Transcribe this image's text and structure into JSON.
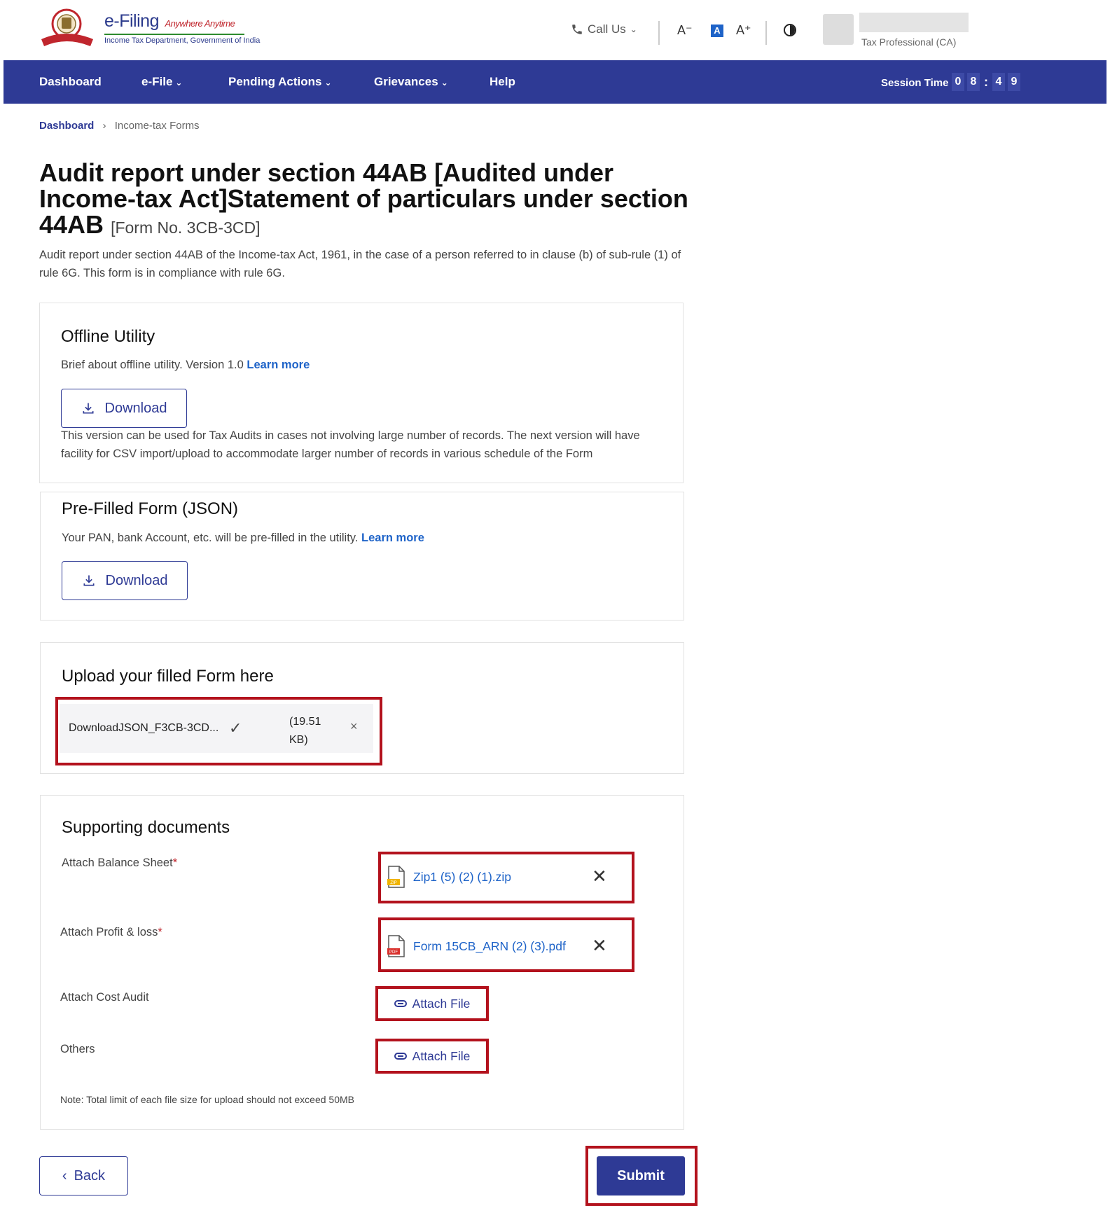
{
  "header": {
    "brand_title": "e-Filing",
    "brand_tagline": "Anywhere Anytime",
    "brand_subtitle": "Income Tax Department, Government of India",
    "call_us": "Call Us",
    "font_decrease": "A⁻",
    "font_normal": "A",
    "font_increase": "A⁺",
    "user_role": "Tax Professional (CA)"
  },
  "nav": {
    "items": [
      {
        "label": "Dashboard"
      },
      {
        "label": "e-File"
      },
      {
        "label": "Pending Actions"
      },
      {
        "label": "Grievances"
      },
      {
        "label": "Help"
      }
    ],
    "session_label": "Session Time",
    "session_digits": [
      "0",
      "8",
      "4",
      "9"
    ]
  },
  "breadcrumb": {
    "home": "Dashboard",
    "current": "Income-tax Forms"
  },
  "page": {
    "title": "Audit report under section 44AB [Audited under Income-tax Act]Statement of particulars under section 44AB",
    "form_no": "[Form No. 3CB-3CD]",
    "description": "Audit report under section 44AB of the Income-tax Act, 1961, in the case of a person referred to in clause (b) of sub-rule (1) of rule 6G. This form is in compliance with rule 6G."
  },
  "offline_utility": {
    "title": "Offline Utility",
    "brief": "Brief about offline utility. Version 1.0",
    "learn_more": "Learn more",
    "download_label": "Download",
    "info": "This version can be used for Tax Audits in cases not involving large number of records. The next version will have facility for CSV import/upload to accommodate larger number of records in various schedule of the Form"
  },
  "prefilled": {
    "title": "Pre-Filled Form (JSON)",
    "brief": "Your PAN, bank Account, etc. will be pre-filled in the utility.",
    "learn_more": "Learn more",
    "download_label": "Download"
  },
  "upload": {
    "title": "Upload your filled Form here",
    "file_name": "DownloadJSON_F3CB-3CD...",
    "file_size": "(19.51 KB)"
  },
  "supporting": {
    "title": "Supporting documents",
    "balance_sheet_label": "Attach Balance Sheet",
    "balance_sheet_file": "Zip1 (5) (2) (1).zip",
    "balance_sheet_file_type": "ZIP",
    "profit_loss_label": "Attach Profit & loss",
    "profit_loss_file": "Form 15CB_ARN (2) (3).pdf",
    "profit_loss_file_type": "PDF",
    "cost_audit_label": "Attach Cost Audit",
    "others_label": "Others",
    "attach_file_label": "Attach File",
    "required_mark": "*",
    "note": "Note: Total limit of each file size for upload should not exceed 50MB"
  },
  "actions": {
    "back_label": "Back",
    "submit_label": "Submit"
  },
  "colors": {
    "primary": "#2e3a95",
    "link": "#1e63c8",
    "highlight": "#b3121d"
  }
}
